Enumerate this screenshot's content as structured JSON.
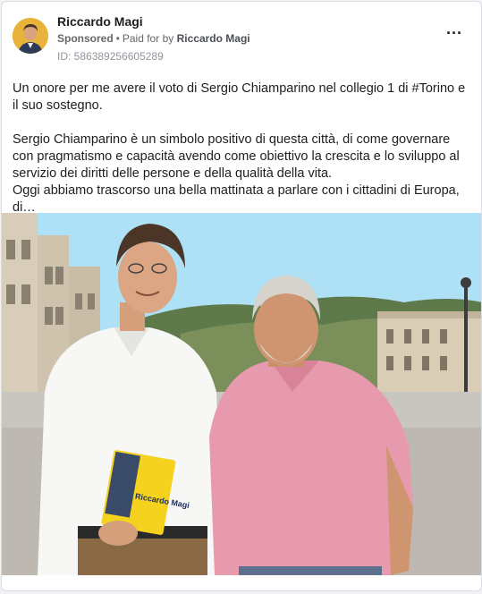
{
  "post": {
    "author": "Riccardo Magi",
    "sponsored": "Sponsored",
    "paid_for_prefix": "Paid for by",
    "paid_for_by": "Riccardo Magi",
    "ad_id": "ID: 586389256605289",
    "more_icon": "···",
    "paragraph_1": "Un onore per me avere il voto di Sergio Chiamparino nel collegio 1 di #Torino e il suo sostegno.",
    "paragraph_2": "Sergio Chiamparino è un simbolo positivo di questa città, di come governare con pragmatismo e capacità avendo come obiettivo la crescita e lo sviluppo al servizio dei diritti delle persone e della qualità della vita.",
    "paragraph_3": "Oggi abbiamo trascorso una bella mattinata a parlare con i cittadini di Europa, di…"
  },
  "image": {
    "leaflet_text": "Riccardo Magi"
  },
  "colors": {
    "sky": "#aee0f6",
    "card_border": "#dadde1",
    "text": "#1c1e21",
    "secondary": "#65676b"
  }
}
